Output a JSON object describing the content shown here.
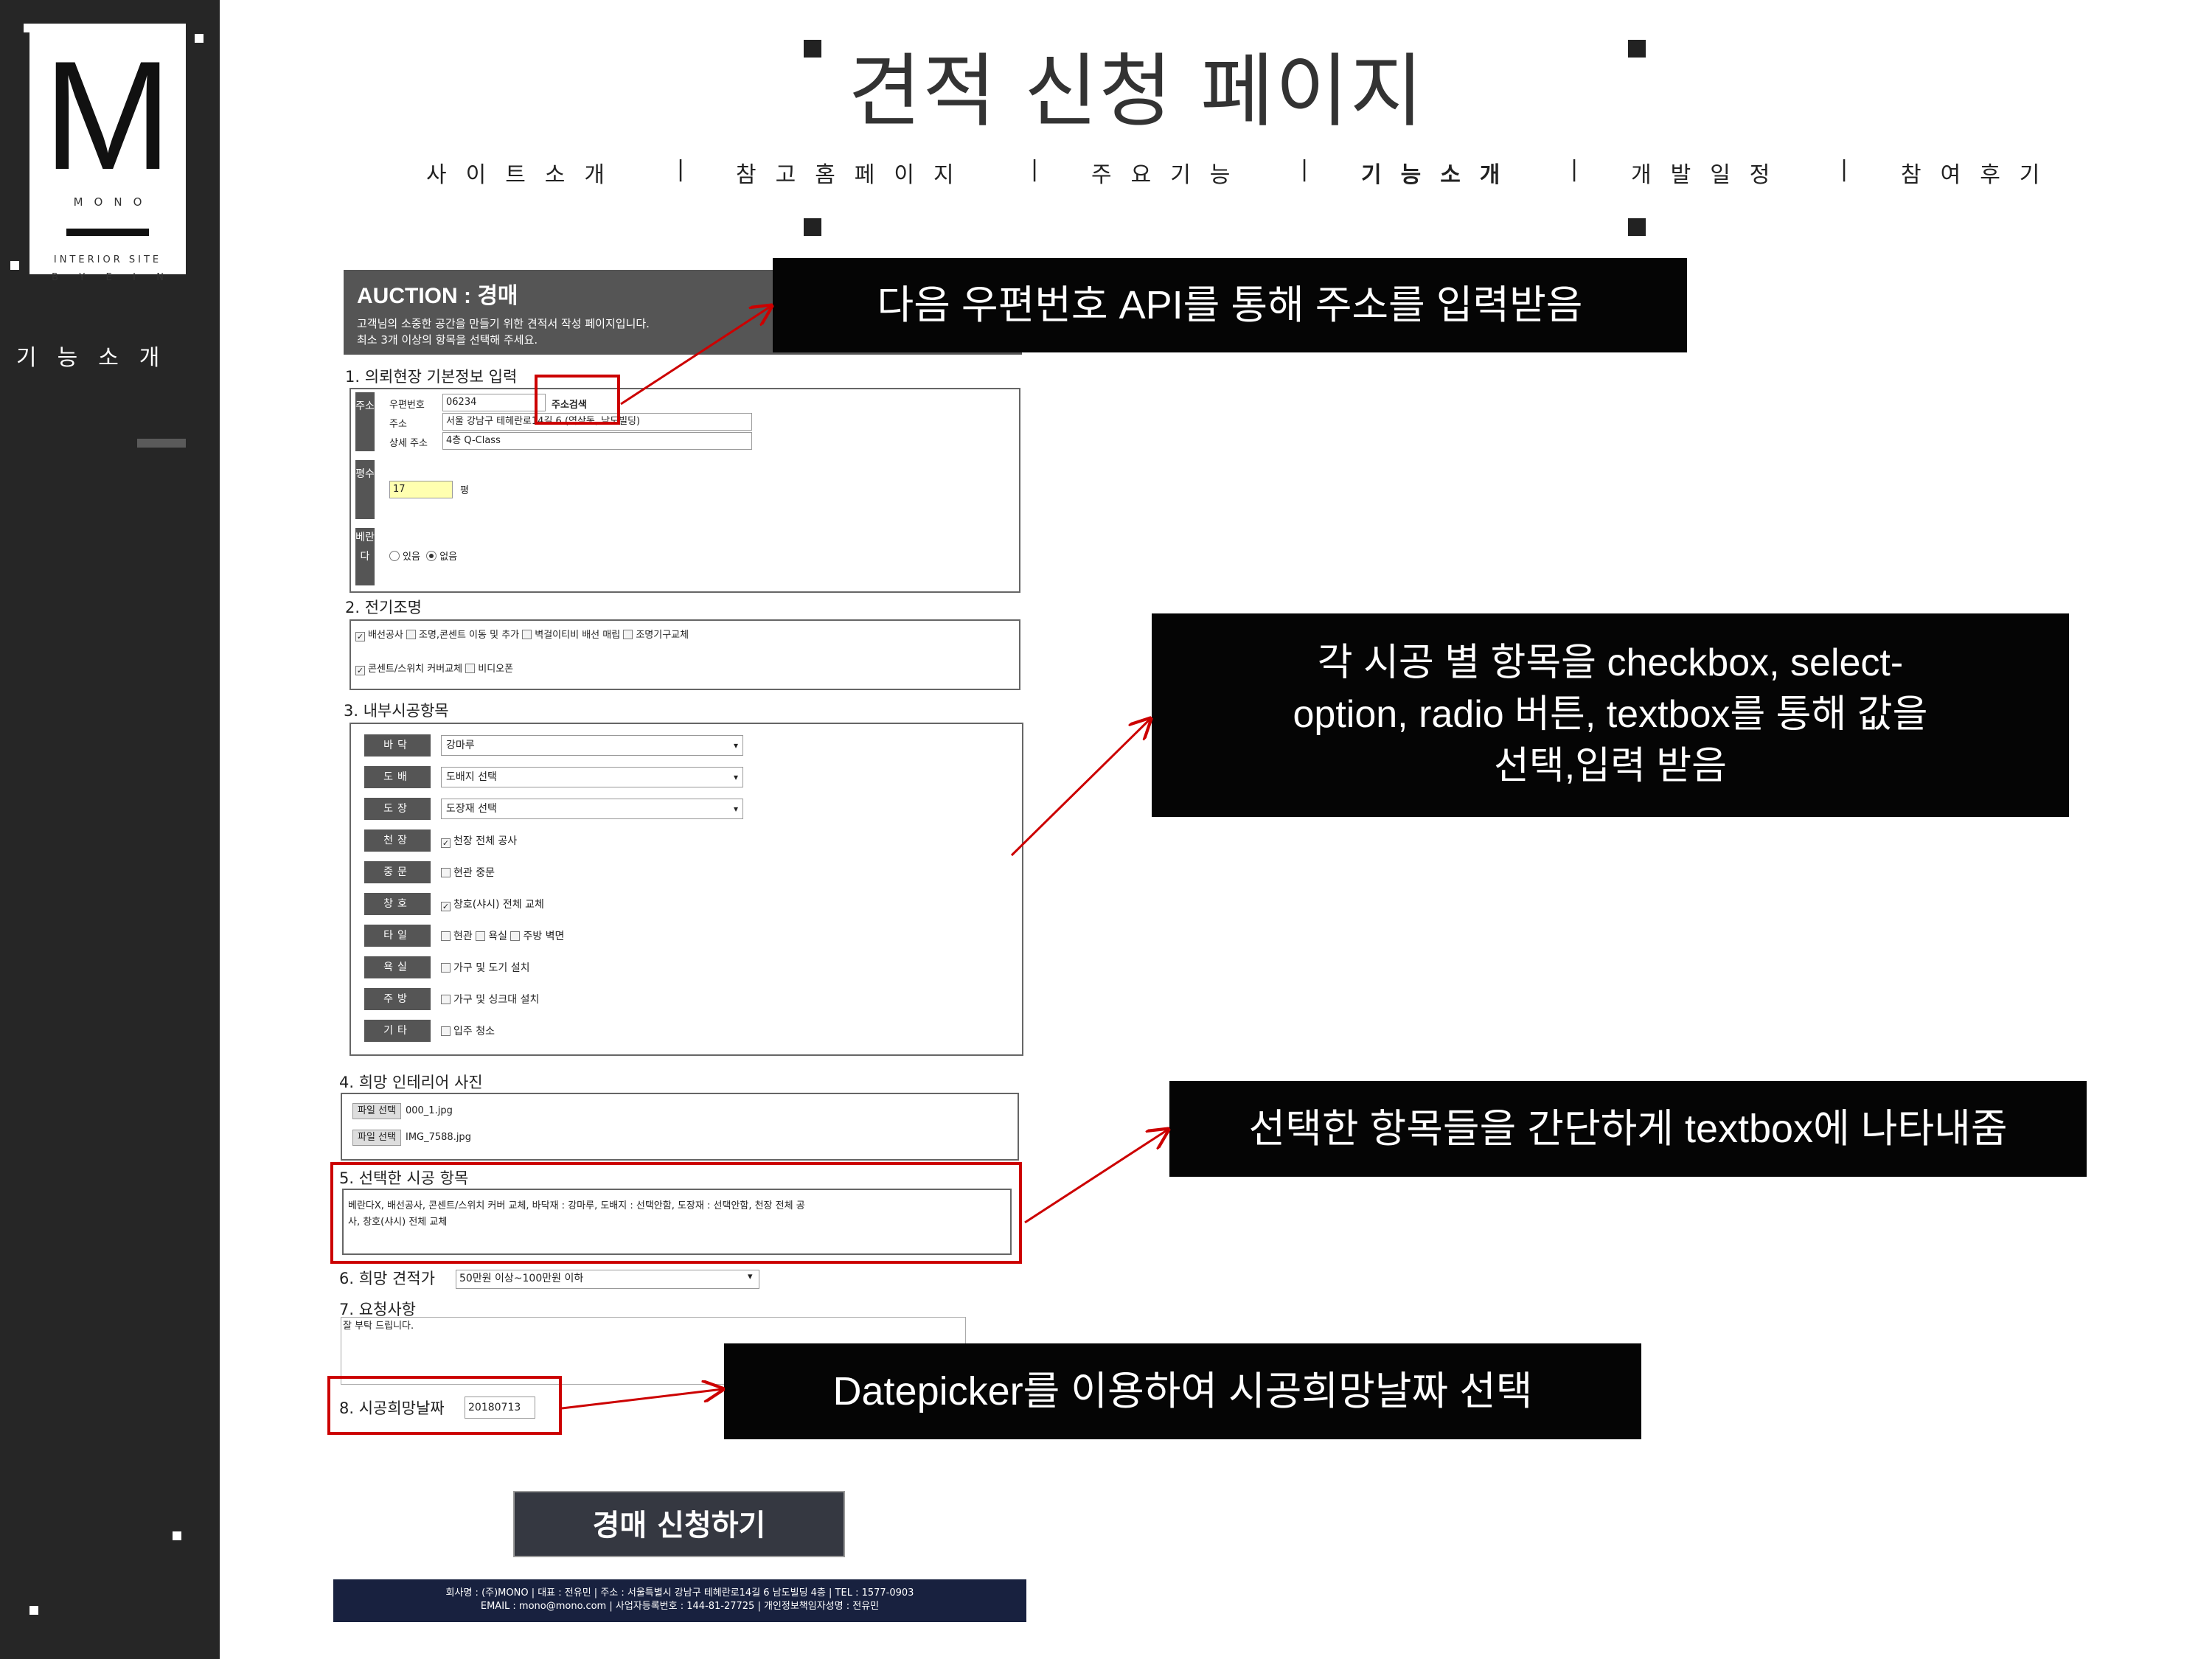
{
  "sidebar": {
    "logo_letter": "M",
    "logo_word": "MONO",
    "logo_sub1": "INTERIOR SITE",
    "logo_sub2": [
      "B",
      "Y",
      "E",
      "I",
      "N"
    ],
    "section_label": "기능소개"
  },
  "header": {
    "title": "견적 신청 페이지",
    "nav": [
      "사이트소개",
      "참고홈페이지",
      "주요기능",
      "기능소개",
      "개발일정",
      "참여후기"
    ],
    "nav_separator": "|"
  },
  "form": {
    "auction_title": "AUCTION : 경매",
    "auction_desc": [
      "고객님의 소중한 공간을 만들기 위한 견적서 작성 페이지입니다.",
      "최소 3개 이상의 항목을 선택해 주세요."
    ],
    "section1": {
      "title": "1. 의뢰현장 기본정보 입력",
      "address_label": "주소",
      "postcode_label": "우편번호",
      "postcode_value": "06234",
      "search_button": "주소검색",
      "address_field_label": "주소",
      "address_value": "서울 강남구 테헤란로14길 6 (역삼동, 남도빌딩)",
      "detail_label": "상세 주소",
      "detail_value": "4층 Q-Class",
      "area_label": "평수",
      "area_value": "17",
      "area_unit": "평",
      "veranda_label": "베란다",
      "veranda_options": [
        "있음",
        "없음"
      ],
      "veranda_selected": "없음"
    },
    "section2": {
      "title": "2. 전기조명",
      "row1": [
        {
          "label": "배선공사",
          "checked": true
        },
        {
          "label": "조명,콘센트 이동 및 추가",
          "checked": false
        },
        {
          "label": "벽걸이티비 배선 매립",
          "checked": false
        },
        {
          "label": "조명기구교체",
          "checked": false
        }
      ],
      "row2": [
        {
          "label": "콘센트/스위치 커버교체",
          "checked": true
        },
        {
          "label": "비디오폰",
          "checked": false
        }
      ]
    },
    "section3": {
      "title": "3. 내부시공항목",
      "rows": [
        {
          "tag": "바닥",
          "type": "select",
          "value": "강마루"
        },
        {
          "tag": "도배",
          "type": "select",
          "value": "도배지 선택"
        },
        {
          "tag": "도장",
          "type": "select",
          "value": "도장재 선택"
        },
        {
          "tag": "천장",
          "type": "check",
          "items": [
            {
              "label": "천장 전체 공사",
              "checked": true
            }
          ]
        },
        {
          "tag": "중문",
          "type": "check",
          "items": [
            {
              "label": "현관 중문",
              "checked": false
            }
          ]
        },
        {
          "tag": "창호",
          "type": "check",
          "items": [
            {
              "label": "창호(샤시) 전체 교체",
              "checked": true
            }
          ]
        },
        {
          "tag": "타일",
          "type": "check",
          "items": [
            {
              "label": "현관",
              "checked": false
            },
            {
              "label": "욕실",
              "checked": false
            },
            {
              "label": "주방 벽면",
              "checked": false
            }
          ]
        },
        {
          "tag": "욕실",
          "type": "check",
          "items": [
            {
              "label": "가구 및 도기 설치",
              "checked": false
            }
          ]
        },
        {
          "tag": "주방",
          "type": "check",
          "items": [
            {
              "label": "가구 및 싱크대 설치",
              "checked": false
            }
          ]
        },
        {
          "tag": "기타",
          "type": "check",
          "items": [
            {
              "label": "입주 청소",
              "checked": false
            }
          ]
        }
      ]
    },
    "section4": {
      "title": "4. 희망 인테리어 사진",
      "file_button": "파일 선택",
      "files": [
        "000_1.jpg",
        "IMG_7588.jpg"
      ]
    },
    "section5": {
      "title": "5. 선택한 시공 항목",
      "text_line1": "베란다X, 배선공사, 콘센트/스위치 커버 교체, 바닥재 : 강마루, 도배지 : 선택안함, 도장재 : 선택안함, 천장 전체 공",
      "text_line2": "사, 창호(샤시) 전체 교체"
    },
    "section6": {
      "title": "6. 희망 견적가",
      "value": "50만원 이상~100만원 이하"
    },
    "section7": {
      "title": "7. 요청사항",
      "value": "잘 부탁 드립니다."
    },
    "section8": {
      "title": "8. 시공희망날짜",
      "value": "20180713"
    },
    "submit": "경매 신청하기",
    "footer": [
      "회사명 : (주)MONO | 대표 : 전유민 | 주소 : 서울특별시 강남구 테헤란로14길 6 남도빌딩 4층 | TEL : 1577-0903",
      "EMAIL : mono@mono.com | 사업자등록번호 : 144-81-27725 | 개인정보책임자성명 : 전유민"
    ]
  },
  "callouts": {
    "c1": "다음 우편번호 API를 통해 주소를 입력받음",
    "c2": [
      "각 시공 별 항목을 checkbox, select-",
      "option, radio 버튼, textbox를 통해 값을",
      "선택,입력 받음"
    ],
    "c3": "선택한 항목들을 간단하게 textbox에 나타내줌",
    "c4": "Datepicker를 이용하여 시공희망날짜 선택"
  },
  "colors": {
    "sidebar": "#262626",
    "callout_bg": "#050505",
    "highlight": "#cc0000",
    "form_header": "#555555",
    "footer": "#18213f"
  }
}
